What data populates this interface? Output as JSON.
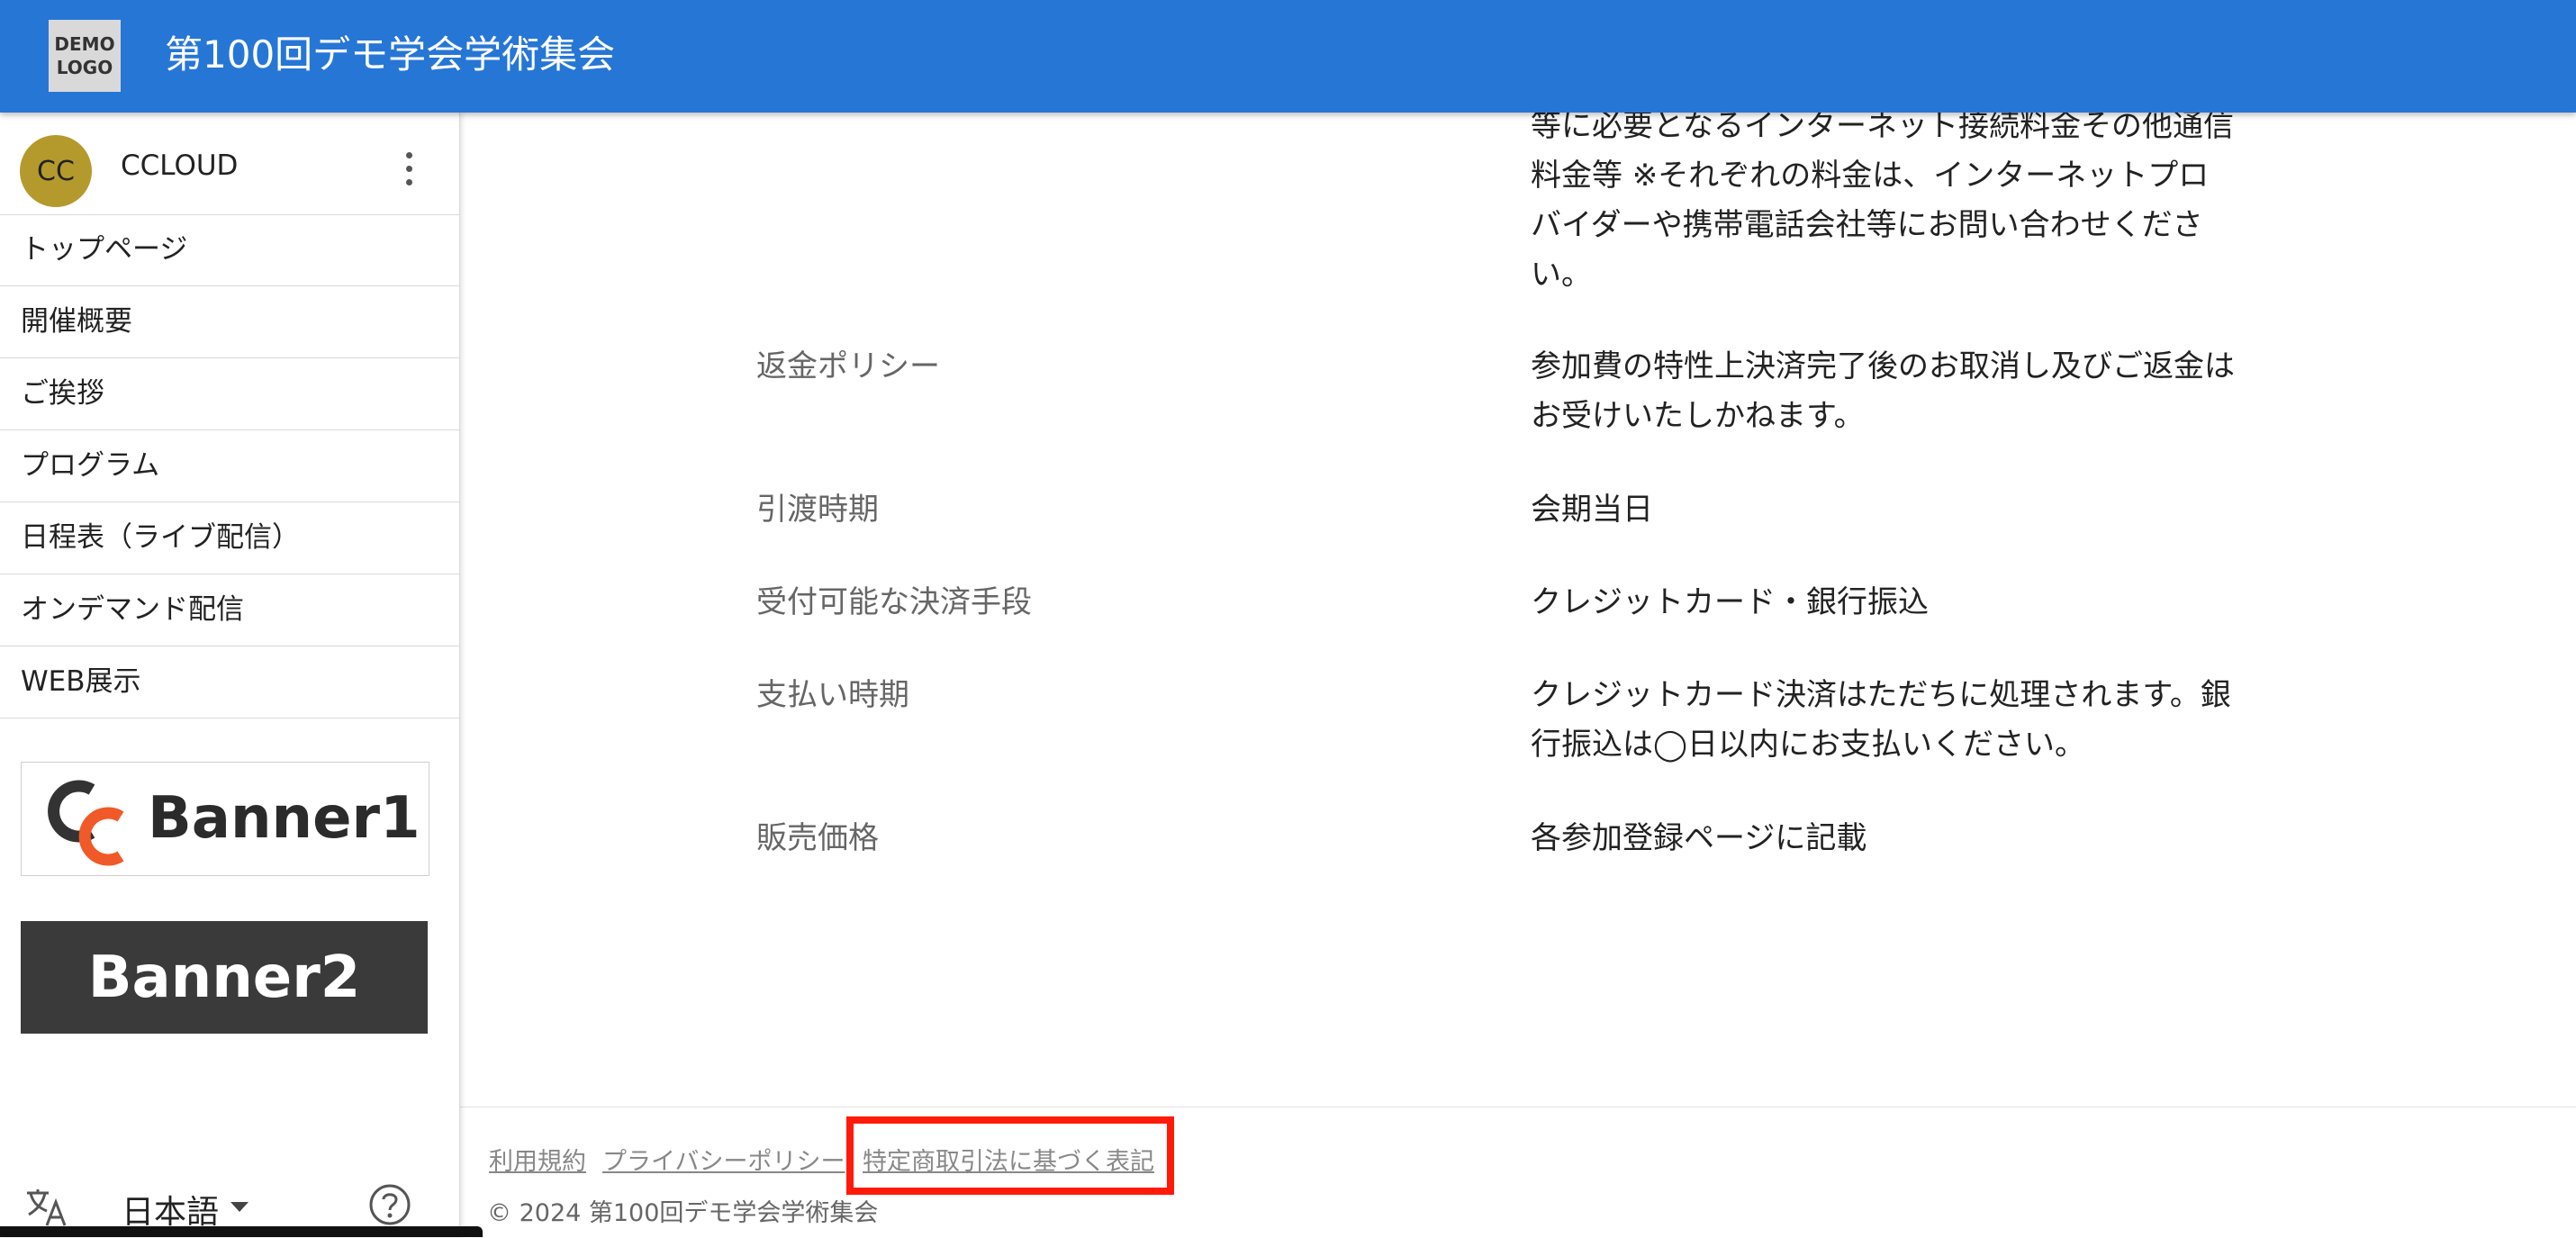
{
  "header": {
    "logo_line1": "DEMO",
    "logo_line2": "LOGO",
    "title": "第100回デモ学会学術集会"
  },
  "sidebar": {
    "user": {
      "initials": "CC",
      "name": "CCLOUD"
    },
    "nav": [
      {
        "label": "トップページ"
      },
      {
        "label": "開催概要"
      },
      {
        "label": "ご挨拶"
      },
      {
        "label": "プログラム"
      },
      {
        "label": "日程表（ライブ配信）"
      },
      {
        "label": "オンデマンド配信"
      },
      {
        "label": "WEB展示"
      }
    ],
    "banners": [
      {
        "label": "Banner1"
      },
      {
        "label": "Banner2"
      }
    ],
    "language": {
      "label": "日本語"
    }
  },
  "content": {
    "top_text": [
      "等に必要となるインターネット接続料金その他通信",
      "料金等 ※それぞれの料金は、インターネットプロ",
      "バイダーや携帯電話会社等にお問い合わせくださ",
      "い。"
    ],
    "rows": [
      {
        "label": "返金ポリシー",
        "value": [
          "参加費の特性上決済完了後のお取消し及びご返金は",
          "お受けいたしかねます。"
        ]
      },
      {
        "label": "引渡時期",
        "value": [
          "会期当日"
        ]
      },
      {
        "label": "受付可能な決済手段",
        "value": [
          "クレジットカード・銀行振込"
        ]
      },
      {
        "label": "支払い時期",
        "value": [
          "クレジットカード決済はただちに処理されます。銀",
          "行振込は◯日以内にお支払いください。"
        ]
      },
      {
        "label": "販売価格",
        "value": [
          "各参加登録ページに記載"
        ]
      }
    ]
  },
  "footer": {
    "links": [
      {
        "label": "利用規約"
      },
      {
        "label": "プライバシーポリシー"
      },
      {
        "label": "特定商取引法に基づく表記"
      }
    ],
    "copyright": "© 2024 第100回デモ学会学術集会"
  },
  "colors": {
    "appbar": "#2676d6",
    "avatar": "#b49a2d",
    "highlight": "#ff1a0a"
  }
}
